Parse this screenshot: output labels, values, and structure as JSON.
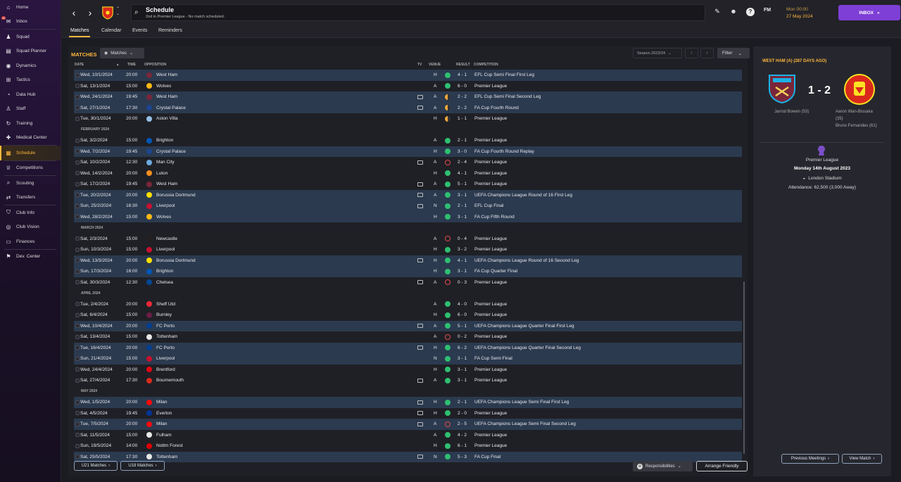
{
  "sidebar": {
    "items": [
      {
        "label": "Home",
        "icon": "home-icon",
        "glyph": "⌂"
      },
      {
        "label": "Inbox",
        "icon": "inbox-icon",
        "glyph": "✉",
        "badge": "35"
      },
      {
        "label": "Squad",
        "icon": "squad-icon",
        "glyph": "♟"
      },
      {
        "label": "Squad Planner",
        "icon": "squad-planner-icon",
        "glyph": "▤"
      },
      {
        "label": "Dynamics",
        "icon": "dynamics-icon",
        "glyph": "◉"
      },
      {
        "label": "Tactics",
        "icon": "tactics-icon",
        "glyph": "⊞"
      },
      {
        "label": "Data Hub",
        "icon": "data-hub-icon",
        "glyph": "◔"
      },
      {
        "label": "Staff",
        "icon": "staff-icon",
        "glyph": "♙"
      },
      {
        "label": "Training",
        "icon": "training-icon",
        "glyph": "↻"
      },
      {
        "label": "Medical Center",
        "icon": "medical-icon",
        "glyph": "✚"
      },
      {
        "label": "Schedule",
        "icon": "schedule-icon",
        "glyph": "▦",
        "active": true
      },
      {
        "label": "Competitions",
        "icon": "trophy-icon",
        "glyph": "♕"
      },
      {
        "label": "Scouting",
        "icon": "scouting-icon",
        "glyph": "⌕"
      },
      {
        "label": "Transfers",
        "icon": "transfers-icon",
        "glyph": "⇄"
      },
      {
        "label": "Club Info",
        "icon": "club-info-icon",
        "glyph": "⛉"
      },
      {
        "label": "Club Vision",
        "icon": "club-vision-icon",
        "glyph": "◎"
      },
      {
        "label": "Finances",
        "icon": "finances-icon",
        "glyph": "▭"
      },
      {
        "label": "Dev. Center",
        "icon": "dev-center-icon",
        "glyph": "⚑"
      }
    ]
  },
  "header": {
    "title": "Schedule",
    "subtitle": "2nd in Premier League - No match scheduled.",
    "date_line1": "Mon 00:00",
    "date_line2": "27 May 2024",
    "inbox_label": "INBOX",
    "fm_label": "FM"
  },
  "tabs": [
    "Matches",
    "Calendar",
    "Events",
    "Reminders"
  ],
  "matches": {
    "title": "MATCHES",
    "view_dropdown": "Matches",
    "season": "Season 2023/24",
    "filter": "Filter",
    "columns": {
      "date": "DATE",
      "time": "TIME",
      "opposition": "OPPOSITION",
      "tv": "TV",
      "venue": "VENUE",
      "result": "RESULT",
      "competition": "COMPETITION"
    },
    "u21": "U21 Matches",
    "u18": "U18 Matches",
    "responsibilities": "Responsibilities",
    "arrange_friendly": "Arrange Friendly"
  },
  "rows": [
    {
      "date": "Wed, 10/1/2024",
      "time": "20:00",
      "opp": "West Ham",
      "crest": "#7a263a",
      "tv": false,
      "venue": "H",
      "res": "win",
      "score": "4 - 1",
      "comp": "EFL Cup Semi Final First Leg",
      "hl": true
    },
    {
      "date": "Sat, 13/1/2024",
      "time": "15:00",
      "opp": "Wolves",
      "crest": "#fdb913",
      "tv": false,
      "venue": "A",
      "res": "win",
      "score": "6 - 0",
      "comp": "Premier League"
    },
    {
      "date": "Wed, 24/1/2024",
      "time": "19:45",
      "opp": "West Ham",
      "crest": "#7a263a",
      "tv": true,
      "venue": "A",
      "res": "draw",
      "score": "2 - 2",
      "comp": "EFL Cup Semi Final Second Leg",
      "hl": true
    },
    {
      "date": "Sat, 27/1/2024",
      "time": "17:30",
      "opp": "Crystal Palace",
      "crest": "#1b458f",
      "tv": true,
      "venue": "A",
      "res": "draw",
      "score": "2 - 2",
      "comp": "FA Cup Fourth Round",
      "hl": true
    },
    {
      "date": "Tue, 30/1/2024",
      "time": "20:00",
      "opp": "Aston Villa",
      "crest": "#95bfe5",
      "tv": false,
      "venue": "H",
      "res": "draw",
      "score": "1 - 1",
      "comp": "Premier League"
    },
    {
      "month": "FEBRUARY 2024"
    },
    {
      "date": "Sat, 3/2/2024",
      "time": "15:00",
      "opp": "Brighton",
      "crest": "#0057b8",
      "tv": false,
      "venue": "A",
      "res": "win",
      "score": "2 - 1",
      "comp": "Premier League"
    },
    {
      "date": "Wed, 7/2/2024",
      "time": "19:45",
      "opp": "Crystal Palace",
      "crest": "#1b458f",
      "tv": false,
      "venue": "H",
      "res": "win",
      "score": "3 - 0",
      "comp": "FA Cup Fourth Round Replay",
      "hl": true
    },
    {
      "date": "Sat, 10/2/2024",
      "time": "12:30",
      "opp": "Man City",
      "crest": "#6cabdd",
      "tv": true,
      "venue": "A",
      "res": "loss",
      "score": "2 - 4",
      "comp": "Premier League"
    },
    {
      "date": "Wed, 14/2/2024",
      "time": "20:00",
      "opp": "Luton",
      "crest": "#f78f1e",
      "tv": false,
      "venue": "H",
      "res": "win",
      "score": "4 - 1",
      "comp": "Premier League"
    },
    {
      "date": "Sat, 17/2/2024",
      "time": "19:45",
      "opp": "West Ham",
      "crest": "#7a263a",
      "tv": true,
      "venue": "A",
      "res": "win",
      "score": "5 - 1",
      "comp": "Premier League"
    },
    {
      "date": "Tue, 20/2/2024",
      "time": "20:00",
      "opp": "Borussia Dortmund",
      "crest": "#fde100",
      "tv": true,
      "venue": "A",
      "res": "win",
      "score": "3 - 1",
      "comp": "UEFA Champions League Round of 16 First Leg",
      "hl": true
    },
    {
      "date": "Sun, 25/2/2024",
      "time": "16:30",
      "opp": "Liverpool",
      "crest": "#c8102e",
      "tv": true,
      "venue": "N",
      "res": "win",
      "score": "2 - 1",
      "comp": "EFL Cup Final",
      "hl": true
    },
    {
      "date": "Wed, 28/2/2024",
      "time": "15:00",
      "opp": "Wolves",
      "crest": "#fdb913",
      "tv": false,
      "venue": "H",
      "res": "win",
      "score": "3 - 1",
      "comp": "FA Cup Fifth Round",
      "hl": true
    },
    {
      "month": "MARCH 2024"
    },
    {
      "date": "Sat, 2/3/2024",
      "time": "15:00",
      "opp": "Newcastle",
      "crest": "#241f20",
      "tv": false,
      "venue": "A",
      "res": "loss",
      "score": "0 - 4",
      "comp": "Premier League"
    },
    {
      "date": "Sun, 10/3/2024",
      "time": "15:00",
      "opp": "Liverpool",
      "crest": "#c8102e",
      "tv": false,
      "venue": "H",
      "res": "win",
      "score": "3 - 2",
      "comp": "Premier League"
    },
    {
      "date": "Wed, 13/3/2024",
      "time": "20:00",
      "opp": "Borussia Dortmund",
      "crest": "#fde100",
      "tv": true,
      "venue": "H",
      "res": "win",
      "score": "4 - 1",
      "comp": "UEFA Champions League Round of 16 Second Leg",
      "hl": true
    },
    {
      "date": "Sun, 17/3/2024",
      "time": "16:00",
      "opp": "Brighton",
      "crest": "#0057b8",
      "tv": false,
      "venue": "H",
      "res": "win",
      "score": "3 - 1",
      "comp": "FA Cup Quarter Final",
      "hl": true
    },
    {
      "date": "Sat, 30/3/2024",
      "time": "12:30",
      "opp": "Chelsea",
      "crest": "#034694",
      "tv": true,
      "venue": "A",
      "res": "loss",
      "score": "0 - 3",
      "comp": "Premier League"
    },
    {
      "month": "APRIL 2024"
    },
    {
      "date": "Tue, 2/4/2024",
      "time": "20:00",
      "opp": "Sheff Utd",
      "crest": "#ee2737",
      "tv": false,
      "venue": "A",
      "res": "win",
      "score": "4 - 0",
      "comp": "Premier League"
    },
    {
      "date": "Sat, 6/4/2024",
      "time": "15:00",
      "opp": "Burnley",
      "crest": "#6c1d45",
      "tv": false,
      "venue": "H",
      "res": "win",
      "score": "6 - 0",
      "comp": "Premier League"
    },
    {
      "date": "Wed, 10/4/2024",
      "time": "20:00",
      "opp": "FC Porto",
      "crest": "#003f91",
      "tv": true,
      "venue": "A",
      "res": "win",
      "score": "5 - 1",
      "comp": "UEFA Champions League Quarter Final First Leg",
      "hl": true
    },
    {
      "date": "Sat, 13/4/2024",
      "time": "15:00",
      "opp": "Tottenham",
      "crest": "#e8e8e8",
      "tv": false,
      "venue": "A",
      "res": "loss",
      "score": "0 - 2",
      "comp": "Premier League"
    },
    {
      "date": "Tue, 16/4/2024",
      "time": "20:00",
      "opp": "FC Porto",
      "crest": "#003f91",
      "tv": true,
      "venue": "H",
      "res": "win",
      "score": "6 - 2",
      "comp": "UEFA Champions League Quarter Final Second Leg",
      "hl": true
    },
    {
      "date": "Sun, 21/4/2024",
      "time": "15:00",
      "opp": "Liverpool",
      "crest": "#c8102e",
      "tv": false,
      "venue": "N",
      "res": "win",
      "score": "3 - 1",
      "comp": "FA Cup Semi Final",
      "hl": true
    },
    {
      "date": "Wed, 24/4/2024",
      "time": "20:00",
      "opp": "Brentford",
      "crest": "#e30613",
      "tv": false,
      "venue": "H",
      "res": "win",
      "score": "3 - 1",
      "comp": "Premier League"
    },
    {
      "date": "Sat, 27/4/2024",
      "time": "17:30",
      "opp": "Bournemouth",
      "crest": "#da291c",
      "tv": true,
      "venue": "A",
      "res": "win",
      "score": "3 - 1",
      "comp": "Premier League"
    },
    {
      "month": "MAY 2024"
    },
    {
      "date": "Wed, 1/5/2024",
      "time": "20:00",
      "opp": "Milan",
      "crest": "#fb090b",
      "tv": true,
      "venue": "H",
      "res": "win",
      "score": "2 - 1",
      "comp": "UEFA Champions League Semi Final First Leg",
      "hl": true
    },
    {
      "date": "Sat, 4/5/2024",
      "time": "19:45",
      "opp": "Everton",
      "crest": "#003399",
      "tv": true,
      "venue": "H",
      "res": "win",
      "score": "2 - 0",
      "comp": "Premier League"
    },
    {
      "date": "Tue, 7/5/2024",
      "time": "20:00",
      "opp": "Milan",
      "crest": "#fb090b",
      "tv": true,
      "venue": "A",
      "res": "loss",
      "score": "2 - 5",
      "comp": "UEFA Champions League Semi Final Second Leg",
      "hl": true
    },
    {
      "date": "Sat, 11/5/2024",
      "time": "15:00",
      "opp": "Fulham",
      "crest": "#e8e8e8",
      "tv": false,
      "venue": "A",
      "res": "win",
      "score": "4 - 2",
      "comp": "Premier League"
    },
    {
      "date": "Sun, 19/5/2024",
      "time": "14:00",
      "opp": "Nottm Forest",
      "crest": "#dd0000",
      "tv": false,
      "venue": "H",
      "res": "win",
      "score": "6 - 1",
      "comp": "Premier League"
    },
    {
      "date": "Sat, 25/5/2024",
      "time": "17:30",
      "opp": "Tottenham",
      "crest": "#e8e8e8",
      "tv": true,
      "venue": "N",
      "res": "win",
      "score": "5 - 3",
      "comp": "FA Cup Final",
      "hl": true
    }
  ],
  "match_detail": {
    "title": "WEST HAM (A) (287 DAYS AGO)",
    "score": "1 - 2",
    "home_scorer": "Jarrod Bowen (53)",
    "away_scorer_1": "Aaron Wan-Bissaka",
    "away_scorer_1b": "(35)",
    "away_scorer_2": "Bruno Fernandes (61)",
    "competition": "Premier League",
    "date": "Monday 14th August 2023",
    "stadium": "London Stadium",
    "attendance": "Attendance: 62,500 (3,000 Away)",
    "previous_meetings": "Previous Meetings",
    "view_match": "View Match"
  },
  "colors": {
    "accent": "#ffb73d",
    "inbox": "#7e3fd6",
    "win": "#2fbf71",
    "draw": "#f0a73a",
    "loss": "#e24a4a",
    "highlight_row": "#2b3a4f"
  }
}
